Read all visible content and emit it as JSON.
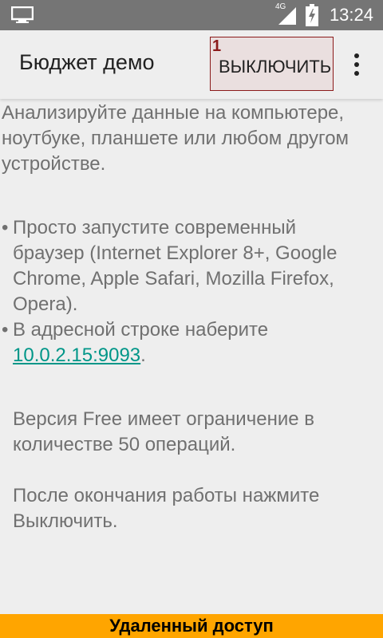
{
  "status_bar": {
    "left_icon": "monitor-icon",
    "network": "4G",
    "signal_icon": "signal-icon",
    "battery_icon": "battery-charging-icon",
    "time": "13:24"
  },
  "app_bar": {
    "title": "Бюджет демо",
    "off_button_marker": "1",
    "off_button_label": "ВЫКЛЮЧИТЬ",
    "overflow_icon": "more-vert-icon"
  },
  "content": {
    "intro": "Анализируйте данные на компьютере, ноутбуке, планшете или любом другом устройстве.",
    "bullets": [
      {
        "text": "Просто запустите современный браузер (Internet Explorer 8+, Google Chrome, Apple Safari, Mozilla Firefox, Opera)."
      },
      {
        "prefix": "В адресной строке наберите ",
        "link": "10.0.2.15:9093",
        "suffix": "."
      }
    ],
    "bullet_char": "•",
    "free_version_note": "Версия Free имеет ограничение в количестве 50 операций.",
    "shutdown_note": "После окончания работы нажмите Выключить."
  },
  "bottom_banner": {
    "label": "Удаленный доступ"
  },
  "colors": {
    "status_bar": "#757575",
    "background": "#eeeeee",
    "link": "#009688",
    "banner": "#ffa500",
    "marker": "#8b1a1a"
  }
}
